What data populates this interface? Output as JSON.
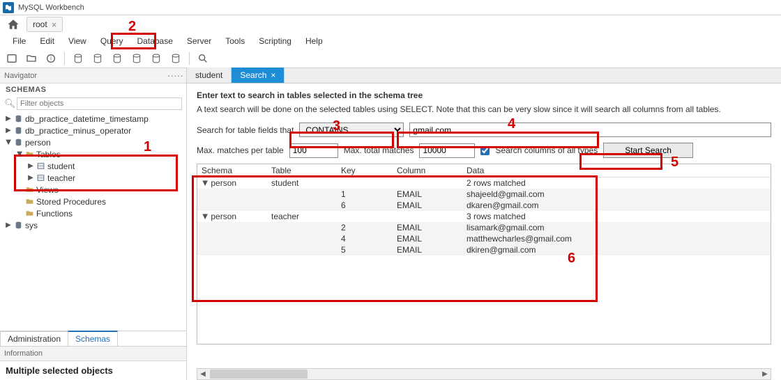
{
  "app": {
    "title": "MySQL Workbench",
    "conn_tab": "root"
  },
  "menu": {
    "file": "File",
    "edit": "Edit",
    "view": "View",
    "query": "Query",
    "database": "Database",
    "server": "Server",
    "tools": "Tools",
    "scripting": "Scripting",
    "help": "Help"
  },
  "navigator": {
    "label": "Navigator",
    "schemas_label": "SCHEMAS",
    "filter_placeholder": "Filter objects"
  },
  "tree": {
    "db1": "db_practice_datetime_timestamp",
    "db2": "db_practice_minus_operator",
    "db3": "person",
    "tables": "Tables",
    "student": "student",
    "teacher": "teacher",
    "views": "Views",
    "sp": "Stored Procedures",
    "fn": "Functions",
    "sys": "sys"
  },
  "sidetabs": {
    "admin": "Administration",
    "schemas": "Schemas"
  },
  "info": {
    "header": "Information",
    "text": "Multiple selected objects"
  },
  "ctabs": {
    "t1": "student",
    "t2": "Search"
  },
  "search": {
    "heading": "Enter text to search in tables selected in the schema tree",
    "desc": "A text search will be done on the selected tables using SELECT. Note that this can be very slow since it will search all columns from all tables.",
    "label1": "Search for table fields that",
    "op": "CONTAINS",
    "term": "gmail.com",
    "max_per_label": "Max. matches per table",
    "max_per": "100",
    "max_total_label": "Max. total matches",
    "max_total": "10000",
    "check_label": "Search columns of all types",
    "start": "Start Search"
  },
  "results": {
    "h_schema": "Schema",
    "h_table": "Table",
    "h_key": "Key",
    "h_column": "Column",
    "h_data": "Data",
    "g1_schema": "person",
    "g1_table": "student",
    "g1_data": "2 rows matched",
    "r1_key": "1",
    "r1_col": "EMAIL",
    "r1_data": "shajeeld@gmail.com",
    "r2_key": "6",
    "r2_col": "EMAIL",
    "r2_data": "dkaren@gmail.com",
    "g2_schema": "person",
    "g2_table": "teacher",
    "g2_data": "3 rows matched",
    "r3_key": "2",
    "r3_col": "EMAIL",
    "r3_data": "lisamark@gmail.com",
    "r4_key": "4",
    "r4_col": "EMAIL",
    "r4_data": "matthewcharles@gmail.com",
    "r5_key": "5",
    "r5_col": "EMAIL",
    "r5_data": "dkiren@gmail.com"
  },
  "annotations": {
    "n1": "1",
    "n2": "2",
    "n3": "3",
    "n4": "4",
    "n5": "5",
    "n6": "6"
  }
}
